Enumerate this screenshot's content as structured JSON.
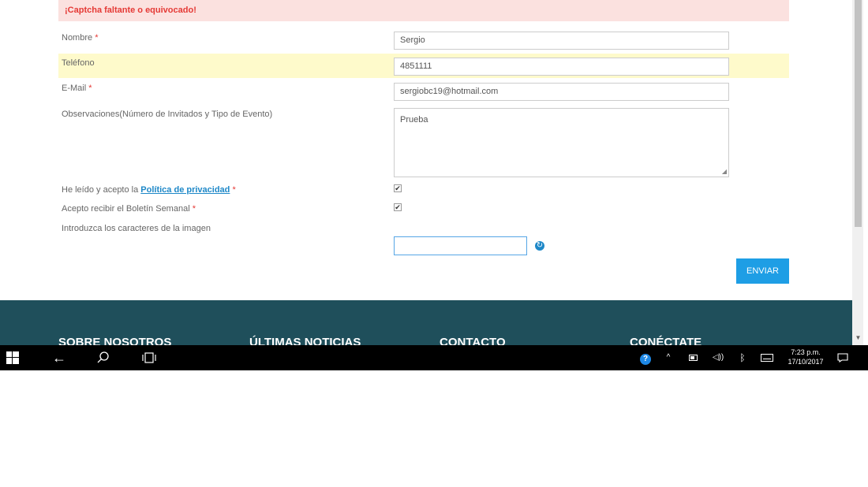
{
  "alert": {
    "message": "¡Captcha faltante o equivocado!"
  },
  "form": {
    "nombre": {
      "label": "Nombre",
      "required_mark": "*",
      "value": "Sergio"
    },
    "telefono": {
      "label": "Teléfono",
      "value": "4851111"
    },
    "email": {
      "label": "E-Mail",
      "required_mark": "*",
      "value": "sergiobc19@hotmail.com"
    },
    "observaciones": {
      "label": "Observaciones(Número de Invitados y Tipo de Evento)",
      "value": "Prueba"
    },
    "privacy": {
      "label_prefix": "He leído y acepto la",
      "link_text": "Política de privacidad",
      "required_mark": "*",
      "checked": true
    },
    "newsletter": {
      "label": "Acepto recibir el Boletín Semanal",
      "required_mark": "*",
      "checked": true
    },
    "captcha": {
      "label": "Introduzca los caracteres de la imagen",
      "value": ""
    },
    "submit_label": "ENVIAR"
  },
  "footer": {
    "headings": [
      "SOBRE NOSOTROS",
      "ÚLTIMAS NOTICIAS",
      "CONTACTO",
      "CONÉCTATE"
    ]
  },
  "taskbar": {
    "time": "7:23 p.m.",
    "date": "17/10/2017",
    "icons": [
      "windows-start-icon",
      "back-arrow-icon",
      "search-icon",
      "task-view-icon",
      "help-icon",
      "chevron-up-icon",
      "battery-icon",
      "volume-icon",
      "bluetooth-icon",
      "keyboard-icon",
      "notifications-icon"
    ]
  },
  "colors": {
    "error_bg": "#fbe1df",
    "error_text": "#e53935",
    "highlight": "#fefacb",
    "button": "#1e9ee5",
    "footer": "#1f4f5b",
    "link": "#1e88c8"
  }
}
